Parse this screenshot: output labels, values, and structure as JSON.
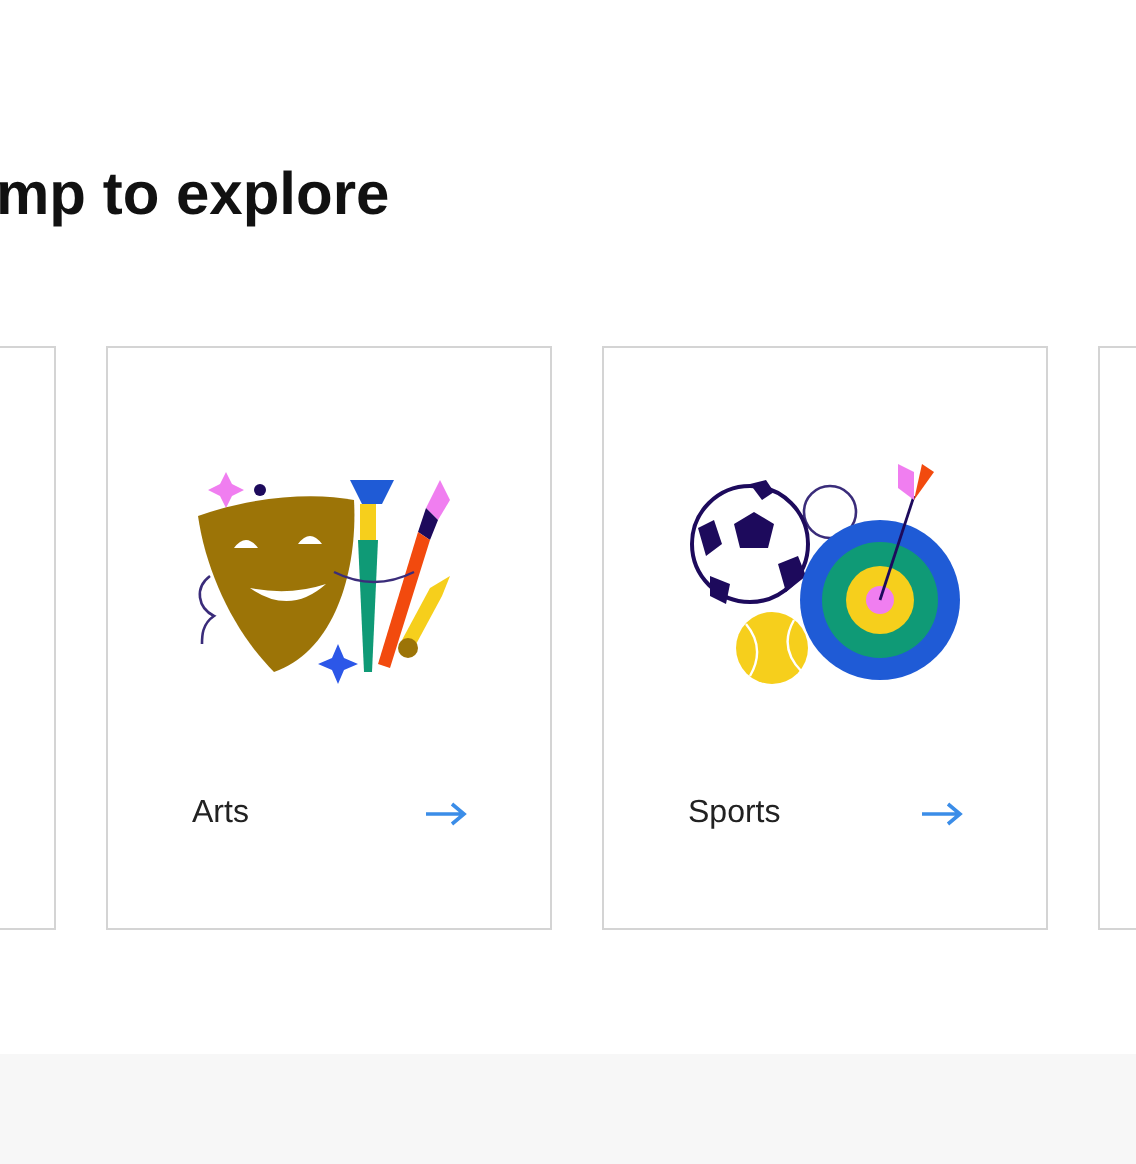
{
  "heading": "mp to explore",
  "cards": [
    {
      "label": "Arts",
      "kind": "arts"
    },
    {
      "label": "Sports",
      "kind": "sports"
    }
  ],
  "edge_cards": {
    "left": true,
    "right": true
  }
}
